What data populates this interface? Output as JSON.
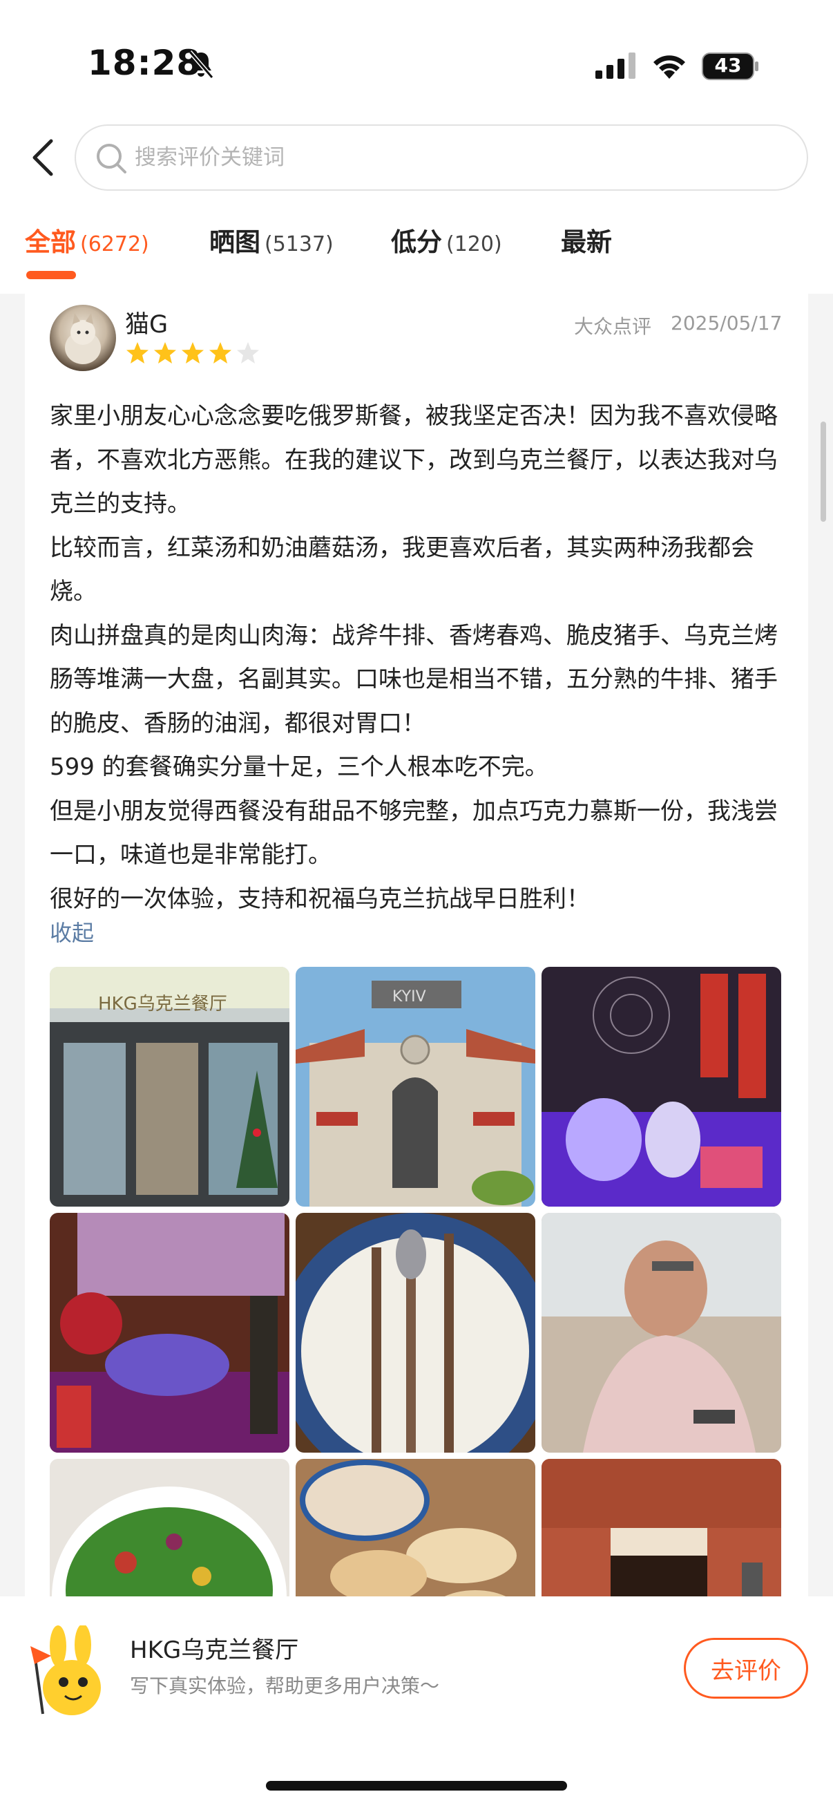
{
  "status_bar": {
    "time": "18:28",
    "battery": "43"
  },
  "search": {
    "placeholder": "搜索评价关键词"
  },
  "tabs": [
    {
      "label": "全部",
      "count": "(6272)",
      "active": true
    },
    {
      "label": "晒图",
      "count": "(5137)",
      "active": false
    },
    {
      "label": "低分",
      "count": "(120)",
      "active": false
    },
    {
      "label": "最新",
      "count": "",
      "active": false
    }
  ],
  "review": {
    "user": "猫G",
    "rating": 4,
    "rating_max": 5,
    "source": "大众点评",
    "date": "2025/05/17",
    "paragraphs": [
      "家里小朋友心心念念要吃俄罗斯餐，被我坚定否决！因为我不喜欢侵略者，不喜欢北方恶熊。在我的建议下，改到乌克兰餐厅，以表达我对乌克兰的支持。",
      "比较而言，红菜汤和奶油蘑菇汤，我更喜欢后者，其实两种汤我都会烧。",
      "肉山拼盘真的是肉山肉海：战斧牛排、香烤春鸡、脆皮猪手、乌克兰烤肠等堆满一大盘，名副其实。口味也是相当不错，五分熟的牛排、猪手的脆皮、香肠的油润，都很对胃口！",
      "599 的套餐确实分量十足，三个人根本吃不完。",
      "但是小朋友觉得西餐没有甜品不够完整，加点巧克力慕斯一份，我浅尝一口，味道也是非常能打。",
      "很好的一次体验，支持和祝福乌克兰抗战早日胜利！"
    ],
    "collapse_label": "收起",
    "photo_sign_text": "HKG乌克兰餐厅",
    "photo_facade_text": "KYIV"
  },
  "bottom": {
    "shop_name": "HKG乌克兰餐厅",
    "hint": "写下真实体验，帮助更多用户决策～",
    "button": "去评价"
  },
  "colors": {
    "accent": "#ff5a1f",
    "star": "#ffc21a",
    "link": "#5b7ca4"
  }
}
